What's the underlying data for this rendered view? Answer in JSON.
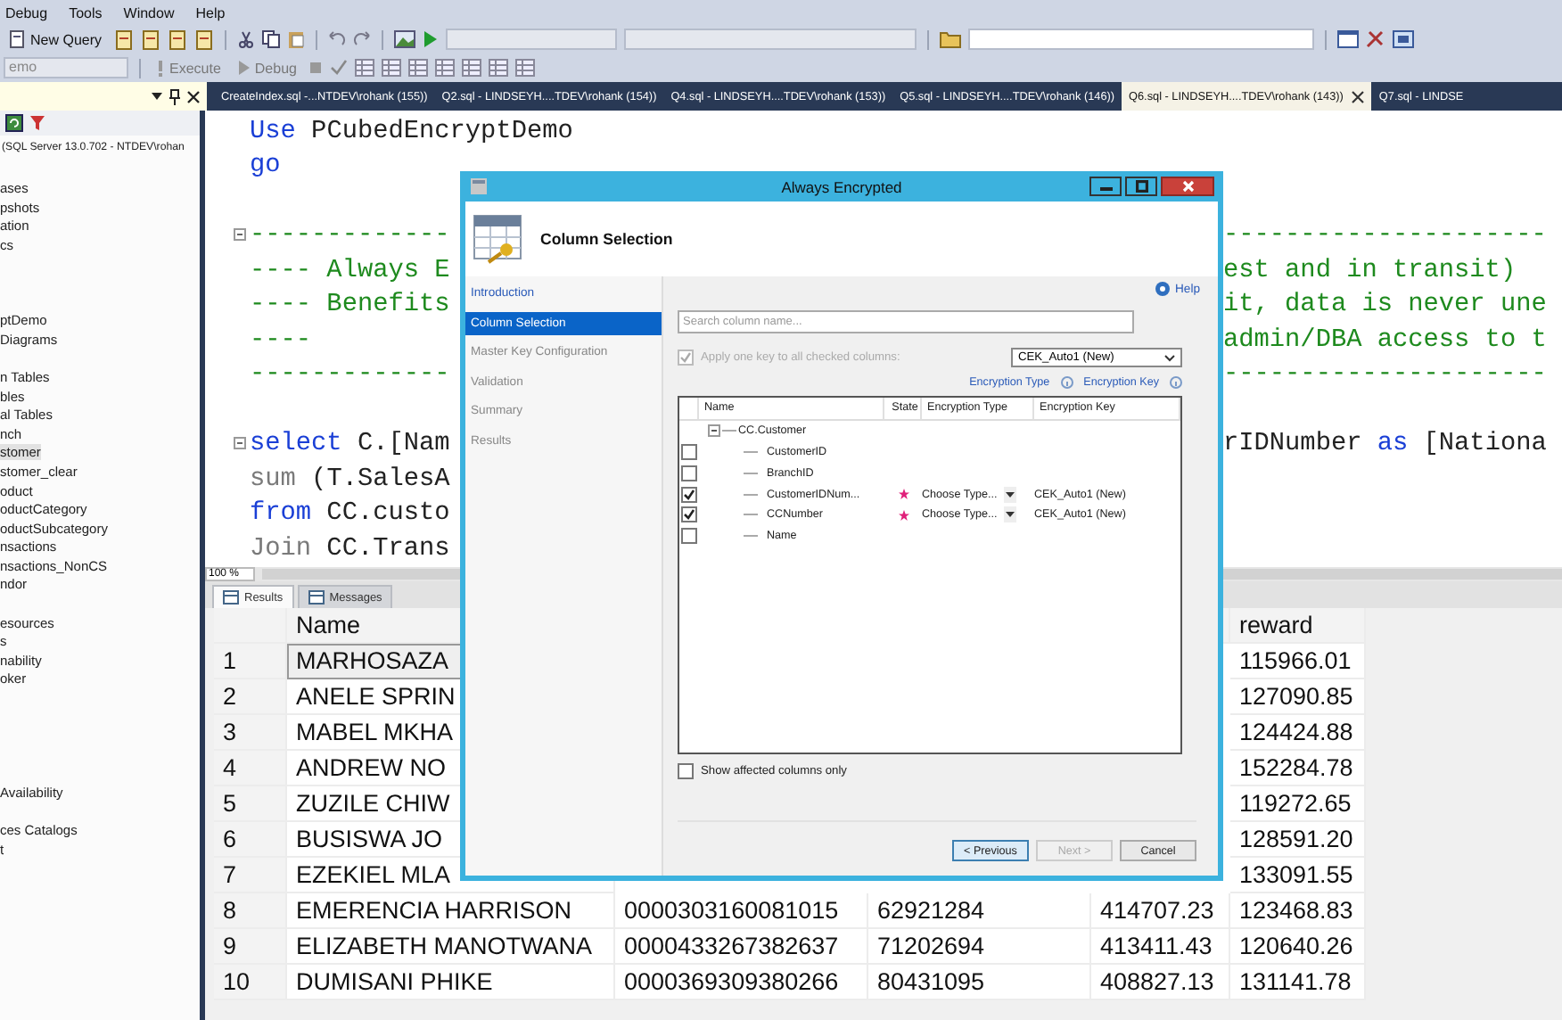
{
  "menu": [
    "Debug",
    "Tools",
    "Window",
    "Help"
  ],
  "toolbar": {
    "new_query": "New Query",
    "database": "emo",
    "execute": "Execute",
    "debug": "Debug"
  },
  "panel_tabs": [
    {
      "label": "CreateIndex.sql -...NTDEV\\rohank (155))",
      "selected": false
    },
    {
      "label": "Q2.sql - LINDSEYH....TDEV\\rohank (154))",
      "selected": false
    },
    {
      "label": "Q4.sql - LINDSEYH....TDEV\\rohank (153))",
      "selected": false
    },
    {
      "label": "Q5.sql - LINDSEYH....TDEV\\rohank (146))",
      "selected": false
    },
    {
      "label": "Q6.sql - LINDSEYH....TDEV\\rohank (143))",
      "selected": true
    },
    {
      "label": "Q7.sql - LINDSE",
      "selected": false
    }
  ],
  "object_explorer": {
    "server": "(SQL Server 13.0.702 - NTDEV\\rohan",
    "groups": [
      {
        "items": [
          {
            "label": "ases",
            "selected": false
          },
          {
            "label": "pshots",
            "selected": false
          },
          {
            "label": "ation",
            "selected": false
          },
          {
            "label": "cs",
            "selected": false
          }
        ]
      },
      {
        "items": [
          {
            "label": "ptDemo",
            "selected": false
          },
          {
            "label": "Diagrams",
            "selected": false
          }
        ]
      },
      {
        "items": [
          {
            "label": "n Tables",
            "selected": false
          },
          {
            "label": "bles",
            "selected": false
          },
          {
            "label": "al Tables",
            "selected": false
          },
          {
            "label": "nch",
            "selected": false
          },
          {
            "label": "stomer",
            "selected": true
          },
          {
            "label": "stomer_clear",
            "selected": false
          },
          {
            "label": "oduct",
            "selected": false
          },
          {
            "label": "oductCategory",
            "selected": false
          },
          {
            "label": "oductSubcategory",
            "selected": false
          },
          {
            "label": "nsactions",
            "selected": false
          },
          {
            "label": "nsactions_NonCS",
            "selected": false
          },
          {
            "label": "ndor",
            "selected": false
          }
        ]
      },
      {
        "items": [
          {
            "label": "esources",
            "selected": false
          },
          {
            "label": "s",
            "selected": false
          },
          {
            "label": "nability",
            "selected": false
          },
          {
            "label": "oker",
            "selected": false
          }
        ]
      },
      {
        "items": [
          {
            "label": "Availability",
            "selected": false
          }
        ]
      },
      {
        "items": [
          {
            "label": "ces Catalogs",
            "selected": false
          },
          {
            "label": "t",
            "selected": false
          }
        ]
      }
    ]
  },
  "editor": {
    "blocks": [
      {
        "lines": [
          {
            "left": [
              {
                "text": "Use",
                "kind": "keyword"
              },
              {
                "text": " PCubedEncryptDemo",
                "kind": "plain"
              }
            ]
          },
          {
            "left": [
              {
                "text": "go",
                "kind": "keyword"
              }
            ]
          }
        ]
      },
      {
        "lines": [
          {
            "left": [
              {
                "text": "-------------",
                "kind": "comment"
              }
            ],
            "right": [
              {
                "text": "---------------------",
                "kind": "comment"
              }
            ]
          },
          {
            "left": [
              {
                "text": "---- Always E",
                "kind": "comment"
              }
            ],
            "right": [
              {
                "text": "est and in transit)",
                "kind": "comment"
              }
            ]
          },
          {
            "left": [
              {
                "text": "---- Benefits",
                "kind": "comment"
              }
            ],
            "right": [
              {
                "text": "it, data is never une",
                "kind": "comment"
              }
            ]
          },
          {
            "left": [
              {
                "text": "----",
                "kind": "comment"
              }
            ],
            "right": [
              {
                "text": "admin/DBA access to t",
                "kind": "comment"
              }
            ]
          },
          {
            "left": [
              {
                "text": "-------------",
                "kind": "comment"
              }
            ],
            "right": [
              {
                "text": "---------------------",
                "kind": "comment"
              }
            ]
          }
        ]
      },
      {
        "lines": [
          {
            "left": [
              {
                "text": "select",
                "kind": "keyword"
              },
              {
                "text": " C.[Nam",
                "kind": "plain"
              }
            ],
            "right": [
              {
                "text": "rIDNumber ",
                "kind": "plain"
              },
              {
                "text": "as",
                "kind": "keyword"
              },
              {
                "text": " [Nationa",
                "kind": "plain"
              }
            ]
          },
          {
            "left": [
              {
                "text": "sum",
                "kind": "function"
              },
              {
                "text": " (T.SalesA",
                "kind": "plain"
              }
            ]
          },
          {
            "left": [
              {
                "text": "from",
                "kind": "keyword"
              },
              {
                "text": " CC.custo",
                "kind": "plain"
              }
            ]
          },
          {
            "left": [
              {
                "text": "Join",
                "kind": "function"
              },
              {
                "text": " CC.Trans",
                "kind": "plain"
              }
            ]
          }
        ]
      }
    ]
  },
  "zoom": "100 %",
  "results_tabs": [
    {
      "label": "Results",
      "selected": true
    },
    {
      "label": "Messages",
      "selected": false
    }
  ],
  "grid": {
    "headers": {
      "name": "Name",
      "column_5": "reward"
    },
    "rows": [
      {
        "number": "1",
        "name": "MARHOSAZA",
        "column_5": "115966.01",
        "selected": true
      },
      {
        "number": "2",
        "name": "ANELE SPRIN",
        "column_5": "127090.85",
        "selected": false
      },
      {
        "number": "3",
        "name": "MABEL MKHA",
        "column_5": "124424.88",
        "selected": false
      },
      {
        "number": "4",
        "name": "ANDREW NO",
        "column_5": "152284.78",
        "selected": false
      },
      {
        "number": "5",
        "name": "ZUZILE CHIW",
        "column_5": "119272.65",
        "selected": false
      },
      {
        "number": "6",
        "name": "BUSISWA JO",
        "column_5": "128591.20",
        "selected": false
      },
      {
        "number": "7",
        "name": "EZEKIEL MLA",
        "column_5": "133091.55",
        "selected": false
      },
      {
        "number": "8",
        "name": "EMERENCIA HARRISON",
        "column_2": "0000303160081015",
        "column_3": "62921284",
        "column_4": "414707.23",
        "column_5": "123468.83",
        "selected": false
      },
      {
        "number": "9",
        "name": "ELIZABETH MANOTWANA",
        "column_2": "0000433267382637",
        "column_3": "71202694",
        "column_4": "413411.43",
        "column_5": "120640.26",
        "selected": false
      },
      {
        "number": "10",
        "name": "DUMISANI PHIKE",
        "column_2": "0000369309380266",
        "column_3": "80431095",
        "column_4": "408827.13",
        "column_5": "131141.78",
        "selected": false
      }
    ]
  },
  "dialog": {
    "title": "Always Encrypted",
    "page_title": "Column Selection",
    "nav": [
      {
        "label": "Introduction",
        "done": true,
        "selected": false
      },
      {
        "label": "Column Selection",
        "done": false,
        "selected": true
      },
      {
        "label": "Master Key Configuration",
        "done": false,
        "selected": false
      },
      {
        "label": "Validation",
        "done": false,
        "selected": false
      },
      {
        "label": "Summary",
        "done": false,
        "selected": false
      },
      {
        "label": "Results",
        "done": false,
        "selected": false
      }
    ],
    "help": "Help",
    "search": {
      "placeholder": "Search column name..."
    },
    "apply_key": {
      "label": "Apply one key to all checked columns:",
      "checked": true,
      "disabled": true
    },
    "key_select": "CEK_Auto1 (New)",
    "links": [
      "Encryption Type",
      "Encryption Key"
    ],
    "table": {
      "columns": [
        "Name",
        "State",
        "Encryption Type",
        "Encryption Key"
      ],
      "root": {
        "label": "CC.Customer",
        "expanded": true,
        "children": [
          {
            "name": "CustomerID",
            "checked": false
          },
          {
            "name": "BranchID",
            "checked": false
          },
          {
            "name": "CustomerIDNum...",
            "checked": true,
            "encryption_type": "Choose Type...",
            "encryption_key": "CEK_Auto1 (New)"
          },
          {
            "name": "CCNumber",
            "checked": true,
            "encryption_type": "Choose Type...",
            "encryption_key": "CEK_Auto1 (New)"
          },
          {
            "name": "Name",
            "checked": false
          }
        ]
      }
    },
    "show_affected": {
      "label": "Show affected columns only",
      "checked": false
    },
    "buttons": [
      {
        "label": "< Previous",
        "disabled": false,
        "default": true
      },
      {
        "label": "Next >",
        "disabled": true,
        "default": false
      },
      {
        "label": "Cancel",
        "disabled": false,
        "default": false
      }
    ]
  }
}
